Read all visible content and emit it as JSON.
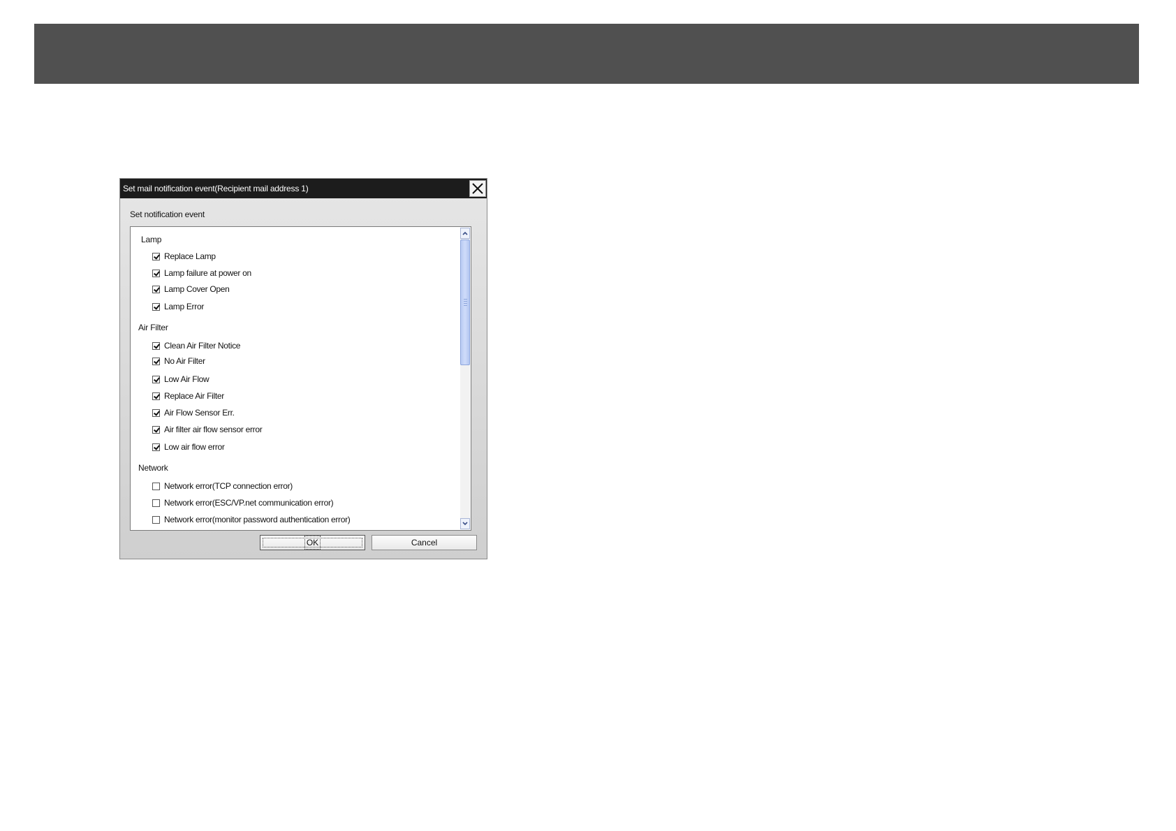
{
  "dialog": {
    "title": "Set mail notification event(Recipient mail address 1)",
    "section_label": "Set notification event",
    "groups": [
      {
        "heading": "Lamp",
        "items": [
          {
            "label": "Replace Lamp",
            "checked": true
          },
          {
            "label": "Lamp failure at power on",
            "checked": true
          },
          {
            "label": "Lamp Cover Open",
            "checked": true
          },
          {
            "label": "Lamp Error",
            "checked": true
          }
        ]
      },
      {
        "heading": "Air Filter",
        "items": [
          {
            "label": "Clean Air Filter Notice",
            "checked": true
          },
          {
            "label": "No Air Filter",
            "checked": true
          },
          {
            "label": "Low Air Flow",
            "checked": true
          },
          {
            "label": "Replace Air Filter",
            "checked": true
          },
          {
            "label": "Air Flow Sensor Err.",
            "checked": true
          },
          {
            "label": "Air filter air flow sensor error",
            "checked": true
          },
          {
            "label": "Low air flow error",
            "checked": true
          }
        ]
      },
      {
        "heading": "Network",
        "items": [
          {
            "label": "Network error(TCP connection error)",
            "checked": false
          },
          {
            "label": "Network error(ESC/VP.net communication error)",
            "checked": false
          },
          {
            "label": "Network error(monitor password authentication error)",
            "checked": false
          }
        ]
      }
    ],
    "ok_label": "OK",
    "cancel_label": "Cancel"
  },
  "colors": {
    "top_band": "#505050",
    "titlebar": "#1c1c1c",
    "scroll_thumb": "#c3d3f7"
  },
  "icons": {
    "close": "close-icon",
    "scroll_up": "chevron-up-icon",
    "scroll_down": "chevron-down-icon",
    "check": "check-icon"
  }
}
